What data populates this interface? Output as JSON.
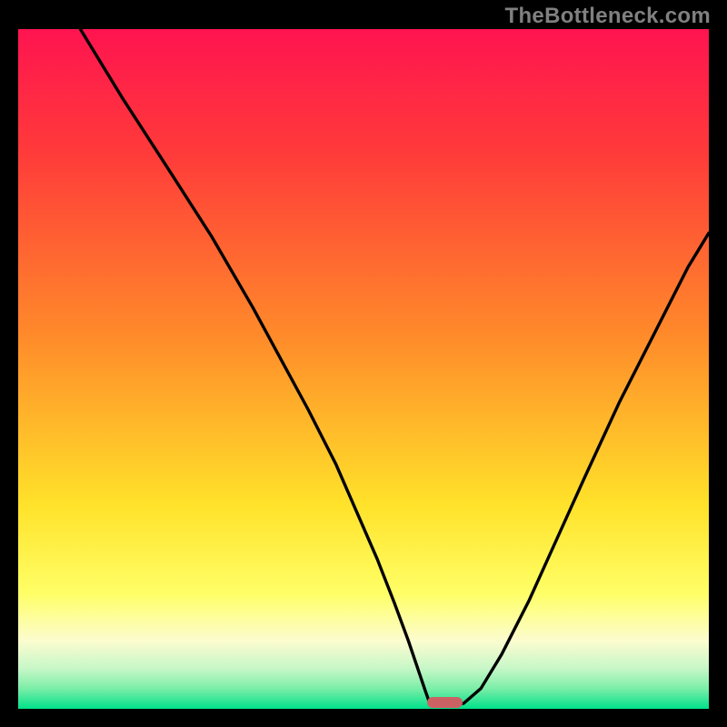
{
  "watermark": "TheBottleneck.com",
  "colors": {
    "bg_black": "#000000",
    "watermark_gray": "#808080",
    "curve_stroke": "#000000",
    "marker_fill": "#cc6164",
    "grad_red_top": "#ff1450",
    "grad_red": "#ff3a3a",
    "grad_orange": "#ff8a2a",
    "grad_yellow": "#ffe22a",
    "grad_yellow_light": "#ffff66",
    "grad_cream": "#fcfccf",
    "grad_pale_green": "#c8f7c8",
    "grad_mint": "#7ceea8",
    "grad_green": "#00e18a"
  },
  "chart_data": {
    "type": "line",
    "title": "",
    "xlabel": "",
    "ylabel": "",
    "xlim": [
      0,
      100
    ],
    "ylim": [
      0,
      100
    ],
    "grid": false,
    "legend": false,
    "annotations": [
      "TheBottleneck.com"
    ],
    "series": [
      {
        "name": "bottleneck-curve",
        "x": [
          9,
          15,
          22,
          28,
          34,
          38,
          42,
          46,
          49,
          52,
          54.5,
          56.5,
          58,
          59,
          59.6,
          61,
          63,
          64.5,
          67,
          70,
          74,
          78,
          82,
          87,
          92,
          97,
          100
        ],
        "y": [
          100,
          90,
          79,
          69.5,
          59,
          51.5,
          44,
          36,
          29,
          22,
          15.5,
          10,
          5.5,
          2.5,
          0.8,
          0.6,
          0.6,
          0.8,
          3,
          8,
          16,
          25,
          34,
          45,
          55,
          65,
          70
        ]
      }
    ],
    "marker": {
      "x": 61.8,
      "y": 0.9,
      "width_pct": 5.2,
      "height_pct": 1.6
    },
    "gradient_stops": [
      {
        "offset": 0,
        "color": "#ff1450"
      },
      {
        "offset": 18,
        "color": "#ff3a3a"
      },
      {
        "offset": 45,
        "color": "#ff8a2a"
      },
      {
        "offset": 70,
        "color": "#ffe22a"
      },
      {
        "offset": 83,
        "color": "#ffff66"
      },
      {
        "offset": 90,
        "color": "#fcfccf"
      },
      {
        "offset": 94,
        "color": "#c8f7c8"
      },
      {
        "offset": 97,
        "color": "#7ceea8"
      },
      {
        "offset": 100,
        "color": "#00e18a"
      }
    ]
  }
}
